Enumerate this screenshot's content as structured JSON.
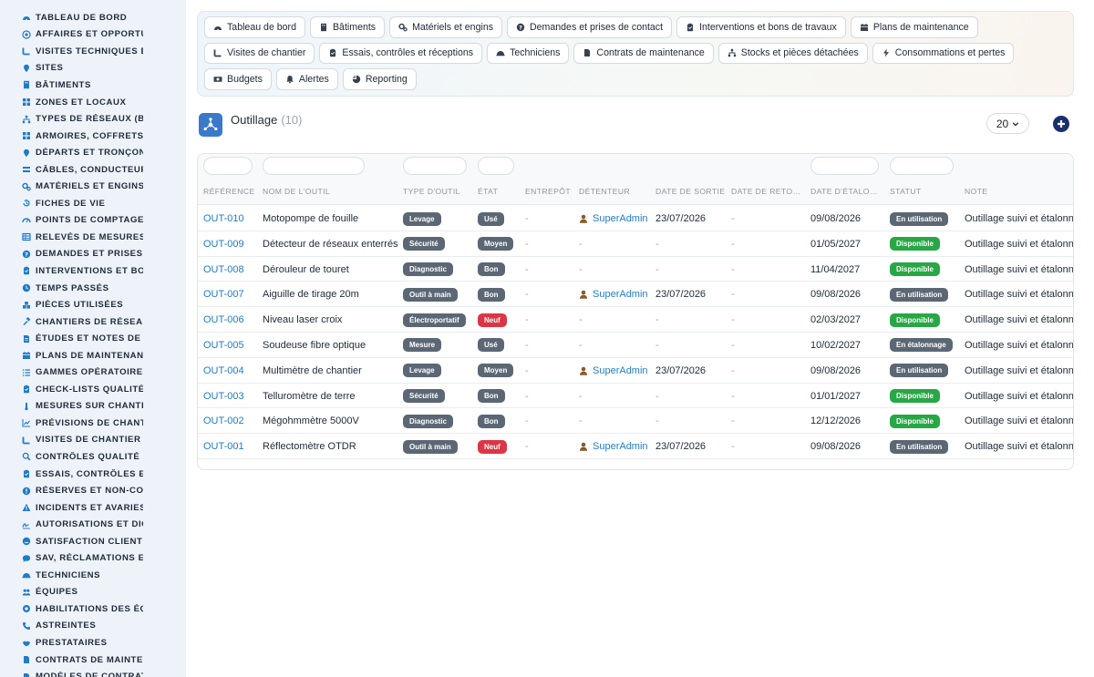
{
  "sidebar": {
    "items": [
      {
        "label": "TABLEAU DE BORD",
        "icon": "dashboard-icon"
      },
      {
        "label": "AFFAIRES ET OPPORTUNITÉS",
        "icon": "target-icon"
      },
      {
        "label": "VISITES TECHNIQUES ET RELEVÉS",
        "icon": "route-icon"
      },
      {
        "label": "SITES",
        "icon": "pin-icon"
      },
      {
        "label": "BÂTIMENTS",
        "icon": "building-icon"
      },
      {
        "label": "ZONES ET LOCAUX",
        "icon": "grid-icon"
      },
      {
        "label": "TYPES DE RÉSEAUX (BT / HTA)",
        "icon": "network-icon"
      },
      {
        "label": "ARMOIRES, COFFRETS ET TGBT",
        "icon": "grid-icon"
      },
      {
        "label": "DÉPARTS ET TRONÇONS",
        "icon": "pin-icon"
      },
      {
        "label": "CÂBLES, CONDUCTEURS",
        "icon": "cable-icon"
      },
      {
        "label": "MATÉRIELS ET ENGINS",
        "icon": "gears-icon"
      },
      {
        "label": "FICHES DE VIE",
        "icon": "history-icon"
      },
      {
        "label": "POINTS DE COMPTAGE ET MESURE",
        "icon": "meter-icon"
      },
      {
        "label": "RELEVÉS DE MESURES",
        "icon": "table-icon"
      },
      {
        "label": "DEMANDES ET PRISES DE CONTACT",
        "icon": "question-icon"
      },
      {
        "label": "INTERVENTIONS ET BONS DE TRAVAUX",
        "icon": "clipboard-icon"
      },
      {
        "label": "TEMPS PASSÉS",
        "icon": "clock-icon"
      },
      {
        "label": "PIÈCES UTILISÉES",
        "icon": "boxes-icon"
      },
      {
        "label": "CHANTIERS DE RÉSEAUX",
        "icon": "hammer-icon"
      },
      {
        "label": "ÉTUDES ET NOTES DE CALCUL",
        "icon": "document-icon"
      },
      {
        "label": "PLANS DE MAINTENANCE",
        "icon": "calendar-icon"
      },
      {
        "label": "GAMMES OPÉRATOIRES",
        "icon": "list-icon"
      },
      {
        "label": "CHECK-LISTS QUALITÉ",
        "icon": "clipboard-icon"
      },
      {
        "label": "MESURES SUR CHANTIER",
        "icon": "thermometer-icon"
      },
      {
        "label": "PRÉVISIONS DE CHANTIER",
        "icon": "chart-icon"
      },
      {
        "label": "VISITES DE CHANTIER",
        "icon": "route-icon"
      },
      {
        "label": "CONTRÔLES QUALITÉ",
        "icon": "search-icon"
      },
      {
        "label": "ESSAIS, CONTRÔLES ET RÉCEPTIONS",
        "icon": "clipboard-icon"
      },
      {
        "label": "RÉSERVES ET NON-CONFORMITÉS",
        "icon": "alert-circle-icon"
      },
      {
        "label": "INCIDENTS ET AVARIES",
        "icon": "warning-icon"
      },
      {
        "label": "AUTORISATIONS ET DICT",
        "icon": "signature-icon"
      },
      {
        "label": "SATISFACTION CLIENT",
        "icon": "smile-icon"
      },
      {
        "label": "SAV, RÉCLAMATIONS ET GARANTIES",
        "icon": "comment-icon"
      },
      {
        "label": "TECHNICIENS",
        "icon": "helmet-icon"
      },
      {
        "label": "ÉQUIPES",
        "icon": "users-icon"
      },
      {
        "label": "HABILITATIONS DES ÉQUIPES",
        "icon": "certificate-icon"
      },
      {
        "label": "ASTREINTES",
        "icon": "phone-icon"
      },
      {
        "label": "PRESTATAIRES",
        "icon": "handshake-icon"
      },
      {
        "label": "CONTRATS DE MAINTENANCE",
        "icon": "file-icon"
      },
      {
        "label": "MODÈLES DE CONTRATS",
        "icon": "file-icon"
      }
    ]
  },
  "nav": {
    "buttons": [
      {
        "label": "Tableau de bord",
        "icon": "dashboard-icon"
      },
      {
        "label": "Bâtiments",
        "icon": "building-icon"
      },
      {
        "label": "Matériels et engins",
        "icon": "gears-icon"
      },
      {
        "label": "Demandes et prises de contact",
        "icon": "question-icon"
      },
      {
        "label": "Interventions et bons de travaux",
        "icon": "clipboard-icon"
      },
      {
        "label": "Plans de maintenance",
        "icon": "calendar-icon"
      },
      {
        "label": "Visites de chantier",
        "icon": "route-icon"
      },
      {
        "label": "Essais, contrôles et réceptions",
        "icon": "clipboard-icon"
      },
      {
        "label": "Techniciens",
        "icon": "helmet-icon"
      },
      {
        "label": "Contrats de maintenance",
        "icon": "file-icon"
      },
      {
        "label": "Stocks et pièces détachées",
        "icon": "network-icon"
      },
      {
        "label": "Consommations et pertes",
        "icon": "bolt-icon"
      },
      {
        "label": "Budgets",
        "icon": "money-icon"
      },
      {
        "label": "Alertes",
        "icon": "bell-icon"
      },
      {
        "label": "Reporting",
        "icon": "pie-icon"
      }
    ]
  },
  "page": {
    "title": "Outillage",
    "count": "(10)",
    "per_page": "20"
  },
  "table": {
    "columns": [
      "RÉFÉRENCE",
      "NOM DE L'OUTIL",
      "TYPE D'OUTIL",
      "ÉTAT",
      "ENTREPÔT",
      "DÉTENTEUR",
      "DATE DE SORTIE",
      "DATE DE RETO…",
      "DATE D'ÉTALO…",
      "STATUT",
      "NOTE"
    ],
    "rows": [
      {
        "ref": "OUT-010",
        "name": "Motopompe de fouille",
        "type": "Levage",
        "etat": "Usé",
        "entrepot": "-",
        "holder": "SuperAdmin",
        "sortie": "23/07/2026",
        "retour": "-",
        "etalonnage": "09/08/2026",
        "statut": "En utilisation",
        "note": "Outillage suivi et étalonné"
      },
      {
        "ref": "OUT-009",
        "name": "Détecteur de réseaux enterrés",
        "type": "Sécurité",
        "etat": "Moyen",
        "entrepot": "-",
        "holder": "-",
        "sortie": "-",
        "retour": "-",
        "etalonnage": "01/05/2027",
        "statut": "Disponible",
        "note": "Outillage suivi et étalonné"
      },
      {
        "ref": "OUT-008",
        "name": "Dérouleur de touret",
        "type": "Diagnostic",
        "etat": "Bon",
        "entrepot": "-",
        "holder": "-",
        "sortie": "-",
        "retour": "-",
        "etalonnage": "11/04/2027",
        "statut": "Disponible",
        "note": "Outillage suivi et étalonné"
      },
      {
        "ref": "OUT-007",
        "name": "Aiguille de tirage 20m",
        "type": "Outil à main",
        "etat": "Bon",
        "entrepot": "-",
        "holder": "SuperAdmin",
        "sortie": "23/07/2026",
        "retour": "-",
        "etalonnage": "09/08/2026",
        "statut": "En utilisation",
        "note": "Outillage suivi et étalonné"
      },
      {
        "ref": "OUT-006",
        "name": "Niveau laser croix",
        "type": "Électroportatif",
        "etat": "Neuf",
        "entrepot": "-",
        "holder": "-",
        "sortie": "-",
        "retour": "-",
        "etalonnage": "02/03/2027",
        "statut": "Disponible",
        "note": "Outillage suivi et étalonné"
      },
      {
        "ref": "OUT-005",
        "name": "Soudeuse fibre optique",
        "type": "Mesure",
        "etat": "Usé",
        "entrepot": "-",
        "holder": "-",
        "sortie": "-",
        "retour": "-",
        "etalonnage": "10/02/2027",
        "statut": "En étalonnage",
        "note": "Outillage suivi et étalonné"
      },
      {
        "ref": "OUT-004",
        "name": "Multimètre de chantier",
        "type": "Levage",
        "etat": "Moyen",
        "entrepot": "-",
        "holder": "SuperAdmin",
        "sortie": "23/07/2026",
        "retour": "-",
        "etalonnage": "09/08/2026",
        "statut": "En utilisation",
        "note": "Outillage suivi et étalonné"
      },
      {
        "ref": "OUT-003",
        "name": "Telluromètre de terre",
        "type": "Sécurité",
        "etat": "Bon",
        "entrepot": "-",
        "holder": "-",
        "sortie": "-",
        "retour": "-",
        "etalonnage": "01/01/2027",
        "statut": "Disponible",
        "note": "Outillage suivi et étalonné"
      },
      {
        "ref": "OUT-002",
        "name": "Mégohmmètre 5000V",
        "type": "Diagnostic",
        "etat": "Bon",
        "entrepot": "-",
        "holder": "-",
        "sortie": "-",
        "retour": "-",
        "etalonnage": "12/12/2026",
        "statut": "Disponible",
        "note": "Outillage suivi et étalonné"
      },
      {
        "ref": "OUT-001",
        "name": "Réflectomètre OTDR",
        "type": "Outil à main",
        "etat": "Neuf",
        "entrepot": "-",
        "holder": "SuperAdmin",
        "sortie": "23/07/2026",
        "retour": "-",
        "etalonnage": "09/08/2026",
        "statut": "En utilisation",
        "note": "Outillage suivi et étalonné"
      }
    ]
  },
  "colors": {
    "accent": "#1f7bc8",
    "badge_grey": "#5b6774",
    "badge_red": "#dc3545",
    "badge_green": "#28a745",
    "add_button": "#1a2f6e",
    "holder_icon": "#8b5a2b"
  }
}
